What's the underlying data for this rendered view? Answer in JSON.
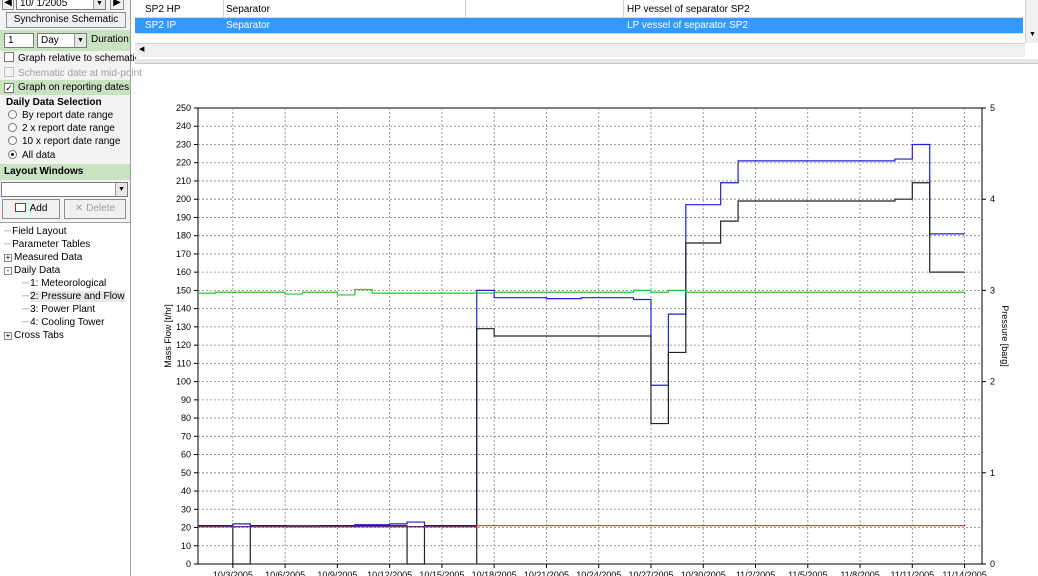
{
  "left": {
    "date_value": "10/  1/2005",
    "sync_button": "Synchronise Schematic",
    "duration_number": "1",
    "duration_unit": "Day",
    "duration_label": "Duration",
    "checks": [
      {
        "label": "Graph relative to schematic",
        "checked": false,
        "disabled": false
      },
      {
        "label": "Schematic date at mid-point",
        "checked": false,
        "disabled": true
      },
      {
        "label": "Graph on reporting dates",
        "checked": true,
        "disabled": false
      }
    ],
    "daily_header": "Daily Data Selection",
    "radios": [
      {
        "label": "By report date range",
        "selected": false
      },
      {
        "label": "2 x report date range",
        "selected": false
      },
      {
        "label": "10 x report date range",
        "selected": false
      },
      {
        "label": "All data",
        "selected": true
      }
    ],
    "layout_header": "Layout Windows",
    "add_label": "Add",
    "delete_label": "Delete",
    "tree": [
      {
        "label": "Field Layout",
        "level": 0,
        "expander": ""
      },
      {
        "label": "Parameter Tables",
        "level": 0,
        "expander": ""
      },
      {
        "label": "Measured Data",
        "level": 0,
        "expander": "+"
      },
      {
        "label": "Daily Data",
        "level": 0,
        "expander": "-"
      },
      {
        "label": "1: Meteorological",
        "level": 1,
        "expander": ""
      },
      {
        "label": "2: Pressure and Flow",
        "level": 1,
        "expander": ""
      },
      {
        "label": "3: Power Plant",
        "level": 1,
        "expander": ""
      },
      {
        "label": "4: Cooling Tower",
        "level": 1,
        "expander": ""
      },
      {
        "label": "Cross Tabs",
        "level": 0,
        "expander": "+"
      }
    ]
  },
  "grid": {
    "rows": [
      {
        "name": "SP2 HP",
        "type": "Separator",
        "desc": "HP vessel of separator SP2",
        "selected": false
      },
      {
        "name": "SP2 IP",
        "type": "Separator",
        "desc": "LP vessel of separator SP2",
        "selected": true
      }
    ]
  },
  "chart_data": {
    "type": "line",
    "step": true,
    "xlabel": "",
    "ylabel": "Mass Flow [t/hr]",
    "y2label": "Pressure [barg]",
    "ylim": [
      0,
      250
    ],
    "y2lim": [
      0,
      5
    ],
    "yticks": [
      0,
      10,
      20,
      30,
      40,
      50,
      60,
      70,
      80,
      90,
      100,
      110,
      120,
      130,
      140,
      150,
      160,
      170,
      180,
      190,
      200,
      210,
      220,
      230,
      240,
      250
    ],
    "y2ticks": [
      0,
      1,
      2,
      3,
      4,
      5
    ],
    "xlim": [
      "2005-10-01",
      "2005-11-15"
    ],
    "xticks": [
      "10/3/2005",
      "10/6/2005",
      "10/9/2005",
      "10/12/2005",
      "10/15/2005",
      "10/18/2005",
      "10/21/2005",
      "10/24/2005",
      "10/27/2005",
      "10/30/2005",
      "11/2/2005",
      "11/5/2005",
      "11/8/2005",
      "11/11/2005",
      "11/14/2005"
    ],
    "grid": true,
    "colors": {
      "blue": "#1f1fd6",
      "black": "#222222",
      "green": "#22cc22",
      "red": "#e03030",
      "purple": "#7a2a7a"
    },
    "series": [
      {
        "axis": "left",
        "color": "blue",
        "points": [
          [
            "2005-10-01",
            21
          ],
          [
            "2005-10-03",
            22
          ],
          [
            "2005-10-04",
            21
          ],
          [
            "2005-10-06",
            20.5
          ],
          [
            "2005-10-08",
            21
          ],
          [
            "2005-10-10",
            21.5
          ],
          [
            "2005-10-12",
            22
          ],
          [
            "2005-10-13",
            23
          ],
          [
            "2005-10-14",
            21
          ],
          [
            "2005-10-17",
            150
          ],
          [
            "2005-10-18",
            146
          ],
          [
            "2005-10-21",
            145.5
          ],
          [
            "2005-10-23",
            146
          ],
          [
            "2005-10-26",
            145
          ],
          [
            "2005-10-27",
            98
          ],
          [
            "2005-10-28",
            137
          ],
          [
            "2005-10-29",
            197
          ],
          [
            "2005-10-31",
            209
          ],
          [
            "2005-11-01",
            221
          ],
          [
            "2005-11-10",
            222
          ],
          [
            "2005-11-11",
            230
          ],
          [
            "2005-11-12",
            181
          ],
          [
            "2005-11-14",
            181
          ]
        ]
      },
      {
        "axis": "left",
        "color": "black",
        "points": [
          [
            "2005-10-01",
            21
          ],
          [
            "2005-10-03",
            0
          ],
          [
            "2005-10-04",
            21
          ],
          [
            "2005-10-11",
            21
          ],
          [
            "2005-10-13",
            0
          ],
          [
            "2005-10-14",
            21
          ],
          [
            "2005-10-16",
            21
          ],
          [
            "2005-10-17",
            0
          ],
          [
            "2005-10-17",
            129
          ],
          [
            "2005-10-18",
            125
          ],
          [
            "2005-10-27",
            77
          ],
          [
            "2005-10-28",
            116
          ],
          [
            "2005-10-29",
            176
          ],
          [
            "2005-10-31",
            188
          ],
          [
            "2005-11-01",
            199
          ],
          [
            "2005-11-10",
            200
          ],
          [
            "2005-11-11",
            209
          ],
          [
            "2005-11-12",
            160
          ],
          [
            "2005-11-14",
            160
          ]
        ]
      },
      {
        "axis": "right",
        "color": "green",
        "points": [
          [
            "2005-10-01",
            2.97
          ],
          [
            "2005-10-02",
            2.98
          ],
          [
            "2005-10-06",
            2.96
          ],
          [
            "2005-10-07",
            2.98
          ],
          [
            "2005-10-09",
            2.95
          ],
          [
            "2005-10-10",
            3.01
          ],
          [
            "2005-10-11",
            2.97
          ],
          [
            "2005-10-18",
            2.98
          ],
          [
            "2005-10-26",
            3.0
          ],
          [
            "2005-10-27",
            2.98
          ],
          [
            "2005-10-28",
            3.0
          ],
          [
            "2005-10-29",
            2.98
          ],
          [
            "2005-11-14",
            2.96
          ]
        ]
      },
      {
        "axis": "right",
        "color": "red",
        "points": [
          [
            "2005-10-01",
            0.41
          ],
          [
            "2005-10-17",
            0.42
          ],
          [
            "2005-11-14",
            0.41
          ]
        ]
      },
      {
        "axis": "left",
        "color": "purple",
        "points": [
          [
            "2005-10-01",
            20.5
          ],
          [
            "2005-10-17",
            20.5
          ]
        ]
      }
    ]
  }
}
